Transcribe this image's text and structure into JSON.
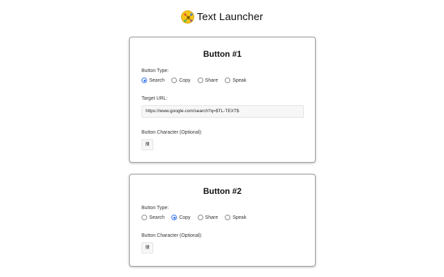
{
  "header": {
    "logo_icon": "text-launcher-logo-icon",
    "title": "Text Launcher"
  },
  "colors": {
    "accent": "#2f6fe8",
    "logo": "#f5c518"
  },
  "cards": [
    {
      "title": "Button #1",
      "type_label": "Button Type:",
      "options": [
        "Search",
        "Copy",
        "Share",
        "Speak"
      ],
      "selected": "Search",
      "url_label": "Target URL:",
      "url_value": "https://www.google.com/search?q=$TL-TEXT$",
      "char_label": "Button Character (Optional):",
      "char_value": "搜"
    },
    {
      "title": "Button #2",
      "type_label": "Button Type:",
      "options": [
        "Search",
        "Copy",
        "Share",
        "Speak"
      ],
      "selected": "Copy",
      "char_label": "Button Character (Optional):",
      "char_value": "搜"
    }
  ]
}
